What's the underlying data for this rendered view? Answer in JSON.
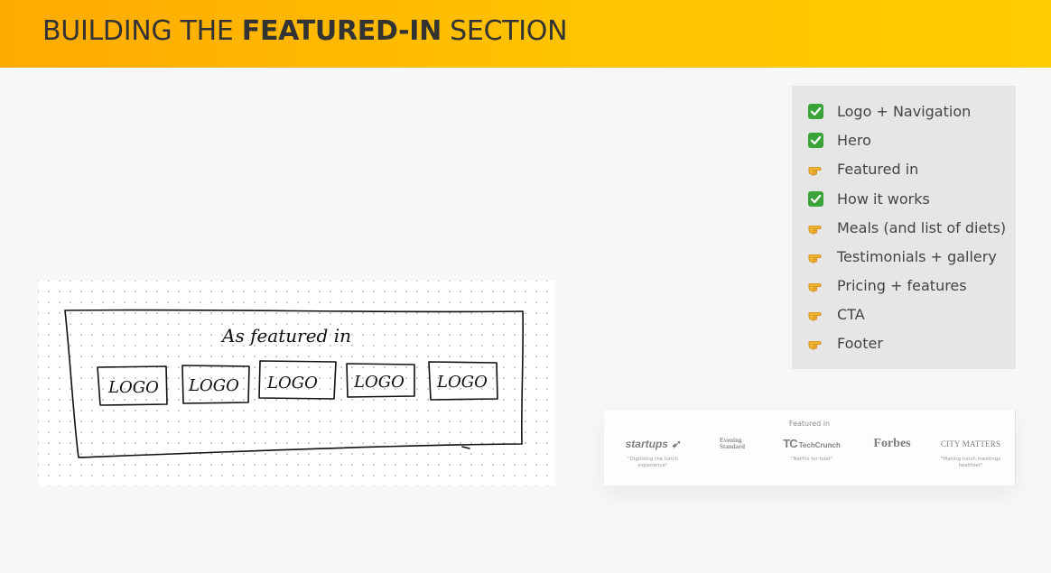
{
  "header": {
    "title_prefix": "BUILDING THE ",
    "title_bold": "FEATURED-IN",
    "title_suffix": " SECTION",
    "bg_color_start": "#ffaa00",
    "bg_color_end": "#ffcc00"
  },
  "checklist": {
    "items": [
      {
        "label": "Logo + Navigation",
        "status": "done",
        "icon": "check-mark-icon"
      },
      {
        "label": "Hero",
        "status": "done",
        "icon": "check-mark-icon"
      },
      {
        "label": "Featured in",
        "status": "todo",
        "icon": "pointing-hand-icon"
      },
      {
        "label": "How it works",
        "status": "done",
        "icon": "check-mark-icon"
      },
      {
        "label": "Meals (and list of diets)",
        "status": "todo",
        "icon": "pointing-hand-icon"
      },
      {
        "label": "Testimonials + gallery",
        "status": "todo",
        "icon": "pointing-hand-icon"
      },
      {
        "label": "Pricing + features",
        "status": "todo",
        "icon": "pointing-hand-icon"
      },
      {
        "label": "CTA",
        "status": "todo",
        "icon": "pointing-hand-icon"
      },
      {
        "label": "Footer",
        "status": "todo",
        "icon": "pointing-hand-icon"
      }
    ],
    "done_color": "#3aa43a",
    "todo_color": "#f2b233"
  },
  "sketch": {
    "heading": "As featured in",
    "logo_placeholders": [
      "LOGO",
      "LOGO",
      "LOGO",
      "LOGO",
      "LOGO"
    ]
  },
  "preview": {
    "heading": "Featured in",
    "logos": [
      {
        "name": "startups",
        "quote": "\"Digitising the lunch experience\""
      },
      {
        "name_line1": "Evening",
        "name_line2": "Standard",
        "quote": ""
      },
      {
        "mark": "TC",
        "name": "TechCrunch",
        "quote": "\"Netflix for food\""
      },
      {
        "name": "Forbes",
        "quote": ""
      },
      {
        "name": "CITY MATTERS",
        "quote": "\"Making lunch meetings healthier\""
      }
    ]
  }
}
